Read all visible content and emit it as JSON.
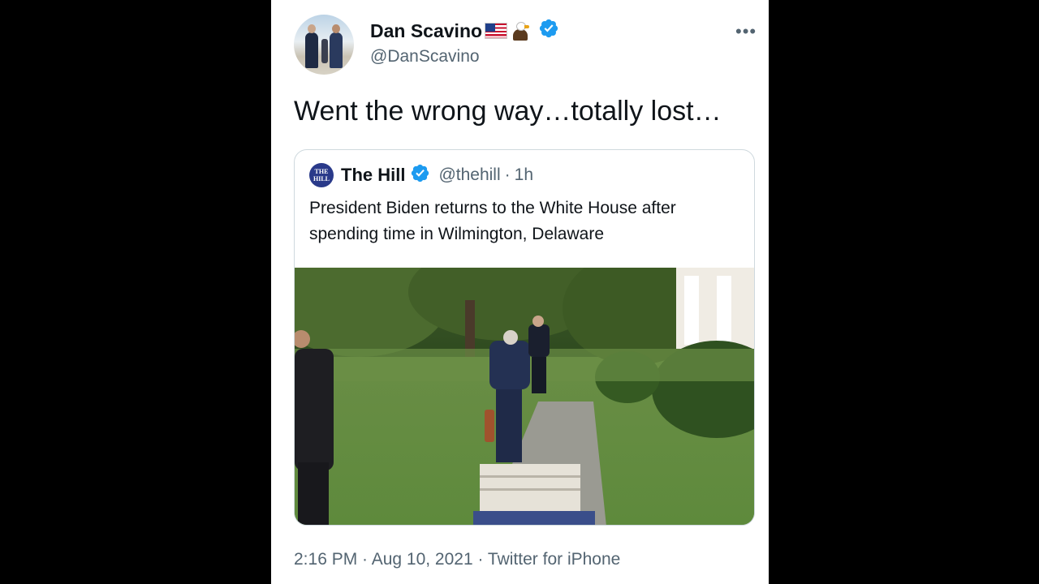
{
  "tweet": {
    "display_name": "Dan Scavino",
    "handle": "@DanScavino",
    "text": "Went the wrong way…totally lost…",
    "more_menu": "•••",
    "timestamp": "2:16 PM · Aug 10, 2021 · Twitter for iPhone"
  },
  "quoted": {
    "logo_text_1": "THE",
    "logo_text_2": "HILL",
    "display_name": "The Hill",
    "handle": "@thehill",
    "separator": "·",
    "time": "1h",
    "text": "President Biden returns to the White House after spending time in Wilmington, Delaware"
  },
  "colors": {
    "verified_blue": "#1d9bf0",
    "text_primary": "#0f1419",
    "text_secondary": "#536471",
    "border": "#cfd9de"
  },
  "icons": {
    "verified": "verified-badge-icon",
    "flag": "us-flag-emoji",
    "eagle": "eagle-emoji",
    "more": "more-options-icon"
  }
}
